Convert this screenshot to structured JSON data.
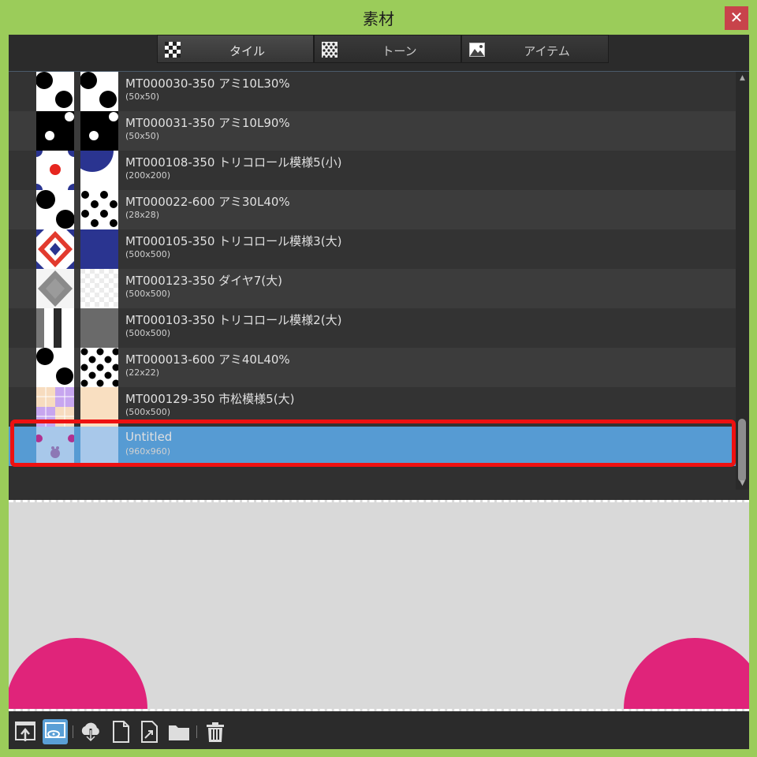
{
  "window": {
    "title": "素材",
    "close_label": "✕"
  },
  "tabs": [
    {
      "label": "タイル",
      "icon": "checker-icon",
      "active": true
    },
    {
      "label": "トーン",
      "icon": "tone-icon",
      "active": false
    },
    {
      "label": "アイテム",
      "icon": "image-icon",
      "active": false
    }
  ],
  "materials": [
    {
      "name": "MT000030-350 アミ10L30%",
      "size": "(50x50)"
    },
    {
      "name": "MT000031-350 アミ10L90%",
      "size": "(50x50)"
    },
    {
      "name": "MT000108-350 トリコロール模様5(小)",
      "size": "(200x200)"
    },
    {
      "name": "MT000022-600 アミ30L40%",
      "size": "(28x28)"
    },
    {
      "name": "MT000105-350 トリコロール模様3(大)",
      "size": "(500x500)"
    },
    {
      "name": "MT000123-350 ダイヤ7(大)",
      "size": "(500x500)"
    },
    {
      "name": "MT000103-350 トリコロール模様2(大)",
      "size": "(500x500)"
    },
    {
      "name": "MT000013-600 アミ40L40%",
      "size": "(22x22)"
    },
    {
      "name": "MT000129-350 市松模様5(大)",
      "size": "(500x500)"
    },
    {
      "name": "Untitled",
      "size": "(960x960)",
      "selected": true
    }
  ],
  "toolbar": [
    {
      "icon": "export-icon"
    },
    {
      "icon": "preview-icon",
      "active": true
    },
    {
      "icon": "download-cloud-icon"
    },
    {
      "icon": "new-file-icon"
    },
    {
      "icon": "edit-file-icon"
    },
    {
      "icon": "folder-icon"
    },
    {
      "icon": "trash-icon"
    }
  ],
  "colors": {
    "background": "#9bcc5a",
    "accent": "#569bd3",
    "highlight": "#ee1111",
    "preview_shape": "#e0247a"
  }
}
